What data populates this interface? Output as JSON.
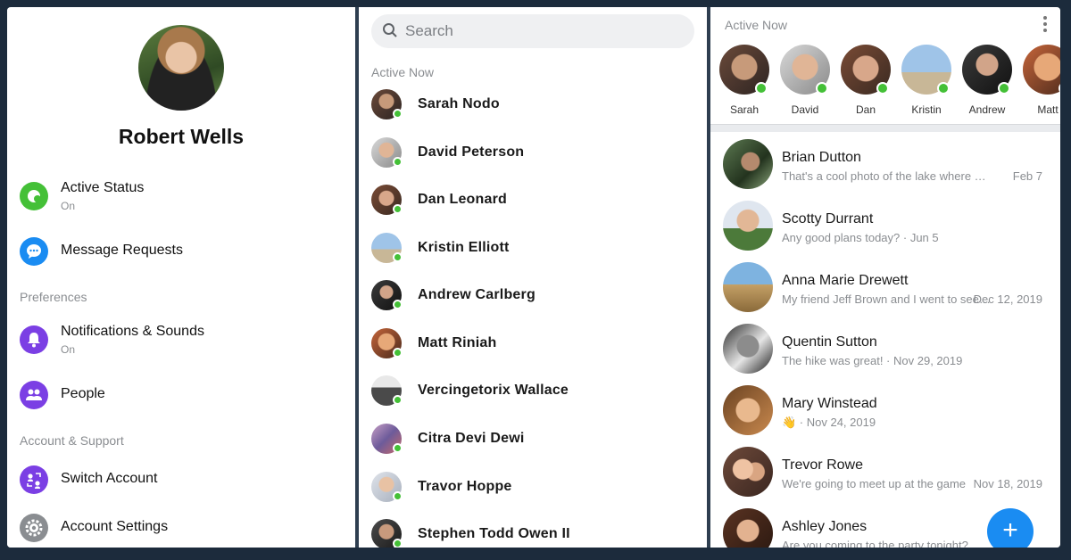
{
  "colors": {
    "accent": "#1a8cf2",
    "online": "#44c037",
    "frame": "#1c2b3c"
  },
  "profile": {
    "name": "Robert Wells"
  },
  "settings": {
    "active_status": {
      "label": "Active Status",
      "sub": "On",
      "icon": "active-status-icon",
      "color": "#44c037"
    },
    "message_requests": {
      "label": "Message Requests",
      "icon": "chat-bubble-icon",
      "color": "#1a8cf2"
    },
    "preferences_heading": "Preferences",
    "notifications": {
      "label": "Notifications & Sounds",
      "sub": "On",
      "icon": "bell-icon",
      "color": "#7b3fe4"
    },
    "people": {
      "label": "People",
      "icon": "people-icon",
      "color": "#7b3fe4"
    },
    "account_heading": "Account & Support",
    "switch_account": {
      "label": "Switch Account",
      "icon": "switch-account-icon",
      "color": "#7b3fe4"
    },
    "account_settings": {
      "label": "Account Settings",
      "icon": "gear-icon",
      "color": "#8a8d91"
    }
  },
  "contacts_panel": {
    "search_placeholder": "Search",
    "heading": "Active Now",
    "contacts": [
      {
        "name": "Sarah Nodo"
      },
      {
        "name": "David Peterson"
      },
      {
        "name": "Dan Leonard"
      },
      {
        "name": "Kristin Elliott"
      },
      {
        "name": "Andrew Carlberg"
      },
      {
        "name": "Matt Riniah"
      },
      {
        "name": "Vercingetorix Wallace"
      },
      {
        "name": "Citra Devi Dewi"
      },
      {
        "name": "Travor Hoppe"
      },
      {
        "name": "Stephen Todd Owen II"
      }
    ]
  },
  "chats_panel": {
    "heading": "Active Now",
    "active": [
      {
        "name": "Sarah"
      },
      {
        "name": "David"
      },
      {
        "name": "Dan"
      },
      {
        "name": "Kristin"
      },
      {
        "name": "Andrew"
      },
      {
        "name": "Matt"
      }
    ],
    "conversations": [
      {
        "name": "Brian Dutton",
        "preview": "That's a cool photo of the lake where you went to visit",
        "date": "Feb 7"
      },
      {
        "name": "Scotty Durrant",
        "preview": "Any good plans today? · Jun 5",
        "date": ""
      },
      {
        "name": "Anna Marie Drewett",
        "preview": "My friend Jeff Brown and I went to see the show",
        "date": "Dec 12, 2019"
      },
      {
        "name": "Quentin Sutton",
        "preview": "The hike was great! · Nov 29, 2019",
        "date": ""
      },
      {
        "name": "Mary Winstead",
        "preview": "👋 · Nov 24, 2019",
        "date": ""
      },
      {
        "name": "Trevor Rowe",
        "preview": "We're going to meet up at the game",
        "date": "Nov 18, 2019"
      },
      {
        "name": "Ashley Jones",
        "preview": "Are you coming to the party tonight?",
        "date": ""
      }
    ]
  }
}
